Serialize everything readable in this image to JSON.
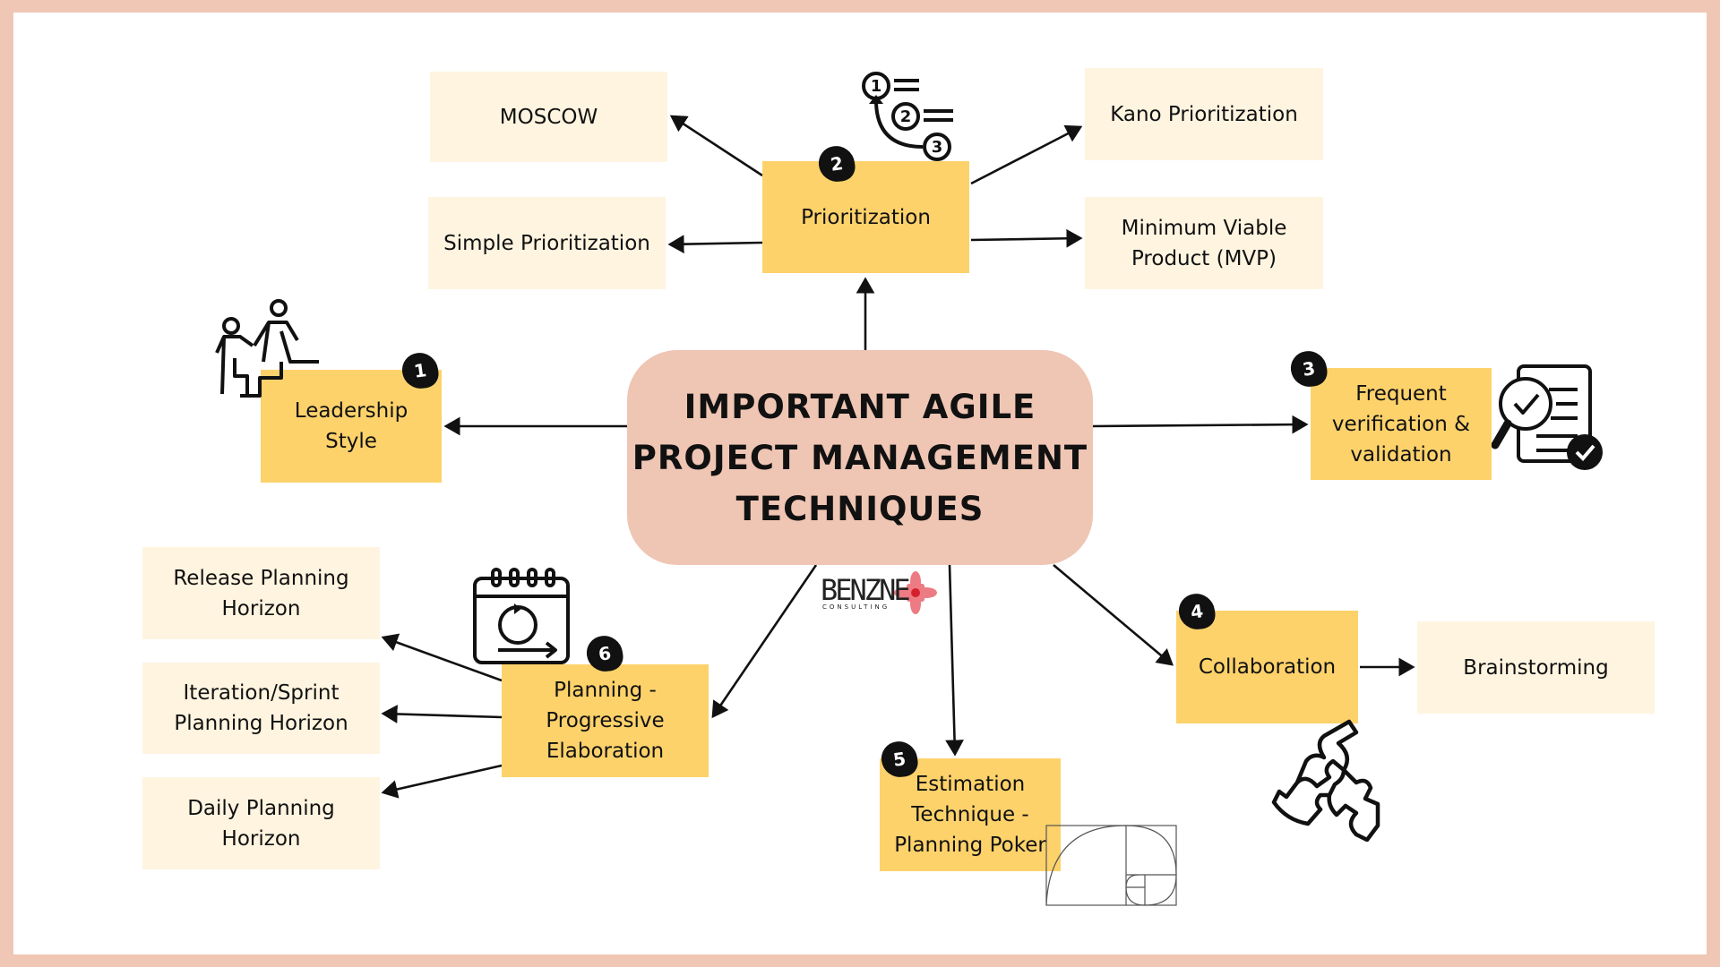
{
  "title": "IMPORTANT AGILE PROJECT MANAGEMENT TECHNIQUES",
  "title_lines": [
    "IMPORTANT AGILE",
    "PROJECT MANAGEMENT",
    "TECHNIQUES"
  ],
  "colors": {
    "frame": "#f0c6b5",
    "center": "#efc5b4",
    "technique_box": "#fdd26b",
    "sub_box": "#fef4e0",
    "badge": "#111111"
  },
  "logo": {
    "name": "BENZNE",
    "sub": "CONSULTING"
  },
  "techniques": [
    {
      "number": "1",
      "label": "Leadership Style",
      "lines": [
        "Leadership",
        "Style"
      ],
      "icon": "people-helping-climb-icon",
      "subtopics": []
    },
    {
      "number": "2",
      "label": "Prioritization",
      "lines": [
        "Prioritization"
      ],
      "icon": "ordered-list-icon",
      "subtopics": [
        "MOSCOW",
        "Simple Prioritization",
        "Kano Prioritization",
        "Minimum Viable Product (MVP)"
      ]
    },
    {
      "number": "3",
      "label": "Frequent verification & validation",
      "lines": [
        "Frequent",
        "verification &",
        "validation"
      ],
      "icon": "document-inspect-check-icon",
      "subtopics": []
    },
    {
      "number": "4",
      "label": "Collaboration",
      "lines": [
        "Collaboration"
      ],
      "icon": "hands-puzzle-icon",
      "subtopics": [
        "Brainstorming"
      ]
    },
    {
      "number": "5",
      "label": "Estimation Technique - Planning Poker",
      "lines": [
        "Estimation",
        "Technique -",
        "Planning Poker"
      ],
      "icon": "fibonacci-spiral-icon",
      "subtopics": []
    },
    {
      "number": "6",
      "label": "Planning - Progressive Elaboration",
      "lines": [
        "Planning -",
        "Progressive",
        "Elaboration"
      ],
      "icon": "sprint-calendar-icon",
      "subtopics": [
        "Release Planning Horizon",
        "Iteration/Sprint Planning Horizon",
        "Daily Planning Horizon"
      ]
    }
  ],
  "subtopic_lines": {
    "moscow": [
      "MOSCOW"
    ],
    "simple": [
      "Simple Prioritization"
    ],
    "kano": [
      "Kano Prioritization"
    ],
    "mvp": [
      "Minimum Viable",
      "Product (MVP)"
    ],
    "brainstorming": [
      "Brainstorming"
    ],
    "release": [
      "Release Planning",
      "Horizon"
    ],
    "iteration": [
      "Iteration/Sprint",
      "Planning Horizon"
    ],
    "daily": [
      "Daily Planning Horizon"
    ]
  }
}
